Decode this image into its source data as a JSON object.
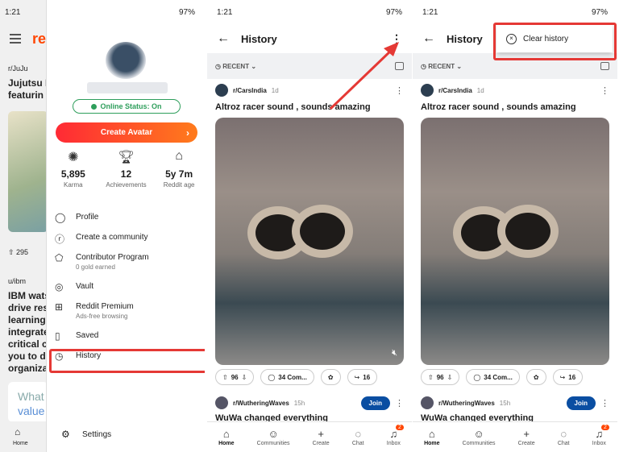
{
  "status_bar": {
    "time": "1:21",
    "battery": "97%"
  },
  "panel1": {
    "bg": {
      "logo": "re",
      "feed_sub1": "r/JuJu",
      "feed_line1": "Jujutsu K",
      "feed_line2": "featurin",
      "votes": "295",
      "feed_sub2": "u/ibm",
      "feed_line3": "IBM wats",
      "feed_line4": "drive res",
      "feed_line5": "learning",
      "feed_line6": "integrate",
      "feed_line7": "critical c",
      "feed_line8": "you to di",
      "feed_line9": "organiza",
      "card_text": "What",
      "card_text2": "value",
      "home_label": "Home"
    },
    "online_status": "Online Status: On",
    "create_avatar": "Create Avatar",
    "stats": [
      {
        "value": "5,895",
        "label": "Karma"
      },
      {
        "value": "12",
        "label": "Achievements"
      },
      {
        "value": "5y 7m",
        "label": "Reddit age"
      }
    ],
    "menu": [
      {
        "label": "Profile",
        "sub": ""
      },
      {
        "label": "Create a community",
        "sub": ""
      },
      {
        "label": "Contributor Program",
        "sub": "0 gold earned"
      },
      {
        "label": "Vault",
        "sub": ""
      },
      {
        "label": "Reddit Premium",
        "sub": "Ads-free browsing"
      },
      {
        "label": "Saved",
        "sub": ""
      },
      {
        "label": "History",
        "sub": ""
      }
    ],
    "settings": "Settings"
  },
  "history": {
    "title": "History",
    "filter": "RECENT",
    "post": {
      "sub": "r/CarsIndia",
      "age": "1d",
      "title": "Altroz racer sound , sounds amazing",
      "upvotes": "96",
      "comments": "34 Com...",
      "shares": "16"
    },
    "next_post": {
      "sub": "r/WutheringWaves",
      "age": "15h",
      "join": "Join",
      "title": "WuWa changed everything"
    },
    "nav": [
      {
        "label": "Home",
        "icon": "home-icon"
      },
      {
        "label": "Communities",
        "icon": "communities-icon"
      },
      {
        "label": "Create",
        "icon": "plus-icon"
      },
      {
        "label": "Chat",
        "icon": "chat-icon"
      },
      {
        "label": "Inbox",
        "icon": "bell-icon"
      }
    ],
    "inbox_badge": "2"
  },
  "clear_history": "Clear history",
  "colors": {
    "highlight": "#e53935",
    "accent": "#ff4500",
    "join": "#0a4ea2",
    "online": "#2e9e5b"
  }
}
